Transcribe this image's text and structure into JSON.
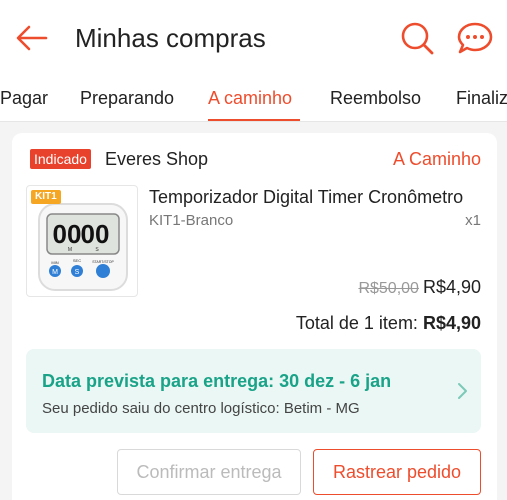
{
  "header": {
    "title": "Minhas compras",
    "back_icon": "arrow-left-icon",
    "search_icon": "search-icon",
    "chat_icon": "chat-icon",
    "accent": "#ee4d2d"
  },
  "tabs": [
    {
      "label": "Pagar"
    },
    {
      "label": "Preparando"
    },
    {
      "label": "A caminho",
      "active": true
    },
    {
      "label": "Reembolso"
    },
    {
      "label": "Finaliz"
    }
  ],
  "order": {
    "badge": "Indicado",
    "shop_name": "Everes Shop",
    "status": "A Caminho",
    "product": {
      "name": "Temporizador Digital Timer Cronômetro",
      "variant": "KIT1-Branco",
      "quantity": "x1",
      "image_tag": "KIT1",
      "display_digits": "00",
      "display_digits2": "00",
      "display_m": "M",
      "display_s": "S",
      "btn_m": "M",
      "btn_s": "S",
      "btn_min": "MIN",
      "btn_sec": "SEC",
      "btn_start": "START/STOP",
      "old_price": "R$50,00",
      "price": "R$4,90"
    },
    "total_label": "Total de 1 item:",
    "total_value": "R$4,90",
    "delivery": {
      "title": "Data prevista para entrega: 30 dez - 6 jan",
      "subtitle": "Seu pedido saiu do centro logístico: Betim - MG",
      "accent": "#1aa388"
    },
    "buttons": {
      "confirm": "Confirmar entrega",
      "track": "Rastrear pedido"
    }
  }
}
